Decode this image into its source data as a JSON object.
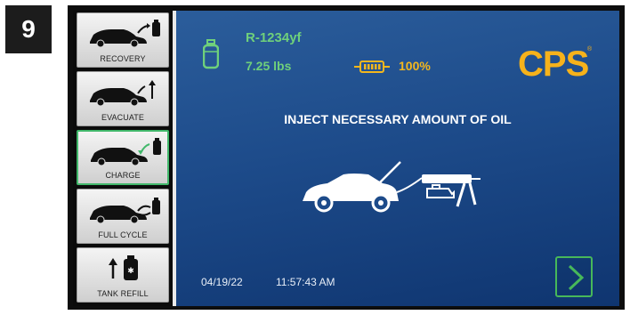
{
  "step": "9",
  "sidebar": {
    "items": [
      {
        "label": "RECOVERY",
        "icon": "car-recovery-icon",
        "active": false
      },
      {
        "label": "EVACUATE",
        "icon": "car-evacuate-icon",
        "active": false
      },
      {
        "label": "CHARGE",
        "icon": "car-charge-icon",
        "active": true
      },
      {
        "label": "FULL CYCLE",
        "icon": "car-full-cycle-icon",
        "active": false
      },
      {
        "label": "TANK REFILL",
        "icon": "tank-refill-icon",
        "active": false
      }
    ]
  },
  "status": {
    "refrigerant": "R-1234yf",
    "weight": "7.25 lbs",
    "battery": "100%"
  },
  "brand": "CPS",
  "instruction": "INJECT NECESSARY AMOUNT OF OIL",
  "footer": {
    "date": "04/19/22",
    "time": "11:57:43 AM"
  },
  "colors": {
    "accent_green": "#6fd07b",
    "battery_yellow": "#f4b71d",
    "brand_yellow": "#f6b21b",
    "screen_blue": "#1d4b8a"
  }
}
